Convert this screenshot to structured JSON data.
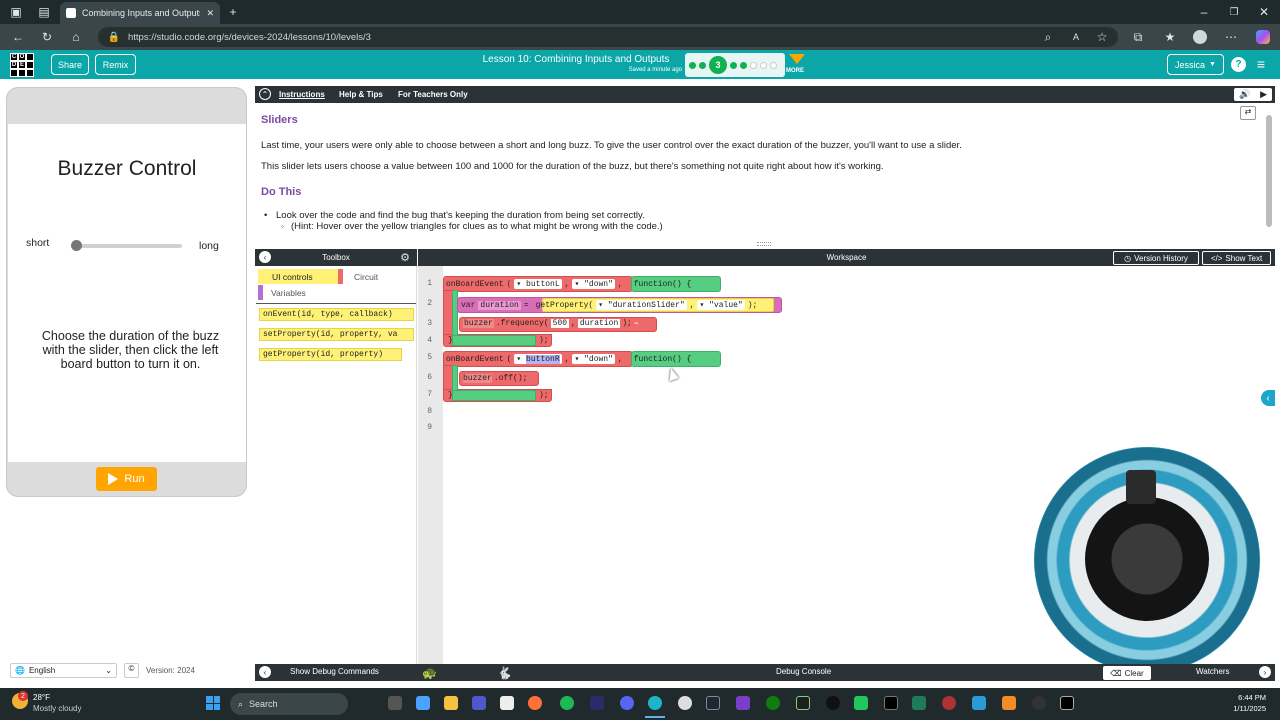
{
  "browser": {
    "tab_title": "Combining Inputs and Outputs #",
    "url": "https://studio.code.org/s/devices-2024/lessons/10/levels/3"
  },
  "header": {
    "logo_letters": [
      "C",
      "O",
      "D",
      "E"
    ],
    "share": "Share",
    "remix": "Remix",
    "lesson_title": "Lesson 10: Combining Inputs and Outputs",
    "saved": "Saved a minute ago",
    "progress_current": "3",
    "more": "MORE",
    "user": "Jessica",
    "help": "?"
  },
  "app": {
    "title": "Buzzer Control",
    "slider_left": "short",
    "slider_right": "long",
    "slider_value": 0,
    "instructions": "Choose the duration of the buzz with the slider, then click the left board button to turn it on.",
    "run": "Run"
  },
  "instructions": {
    "tabs": [
      "Instructions",
      "Help & Tips",
      "For Teachers Only"
    ],
    "heading1": "Sliders",
    "para1": "Last time, your users were only able to choose between a short and long buzz. To give the user control over the exact duration of the buzzer, you'll want to use a slider.",
    "para2": "This slider lets users choose a value between 100 and 1000 for the duration of the buzz, but there's something not quite right about how it's working.",
    "heading2": "Do This",
    "bullet1": "Look over the code and find the bug that's keeping the duration from being set correctly.",
    "bullet2": "(Hint: Hover over the yellow triangles for clues as to what might be wrong with the code.)"
  },
  "toolbox": {
    "title": "Toolbox",
    "categories": [
      "UI controls",
      "Circuit",
      "Variables"
    ],
    "blocks": [
      "onEvent(id, type, callback)",
      "setProperty(id, property, va",
      "getProperty(id, property)"
    ]
  },
  "workspace": {
    "title": "Workspace",
    "version_history": "Version History",
    "show_text": "Show Text",
    "line_numbers": [
      "1",
      "2",
      "3",
      "4",
      "5",
      "6",
      "7",
      "8",
      "9"
    ],
    "code": {
      "l1_fn": "onBoardEvent",
      "l1_arg1": "buttonL",
      "l1_arg2": "\"down\"",
      "l1_fn2": "function() {",
      "l2_var": "var",
      "l2_name": "duration",
      "l2_eq": "=",
      "l2_fn": "getProperty(",
      "l2_a1": "\"durationSlider\"",
      "l2_a2": "\"value\"",
      "l2_end": ");",
      "l3_obj": "buzzer",
      "l3_method": ".frequency(",
      "l3_a1": "500",
      "l3_a2": "duration",
      "l3_end": ");",
      "l4": "}",
      "l4_end": ");",
      "l5_fn": "onBoardEvent",
      "l5_arg1": "buttonR",
      "l5_arg2": "\"down\"",
      "l5_fn2": "function() {",
      "l6_obj": "buzzer",
      "l6_method": ".off();",
      "l7": "}",
      "l7_end": ");"
    }
  },
  "footer": {
    "language": "English",
    "version": "Version: 2024",
    "show_debug": "Show Debug Commands",
    "debug_console": "Debug Console",
    "clear": "Clear",
    "watchers": "Watchers"
  },
  "taskbar": {
    "weather_temp": "28°F",
    "weather_desc": "Mostly cloudy",
    "weather_badge": "2",
    "search": "Search",
    "time": "6:44 PM",
    "date": "1/11/2025"
  }
}
